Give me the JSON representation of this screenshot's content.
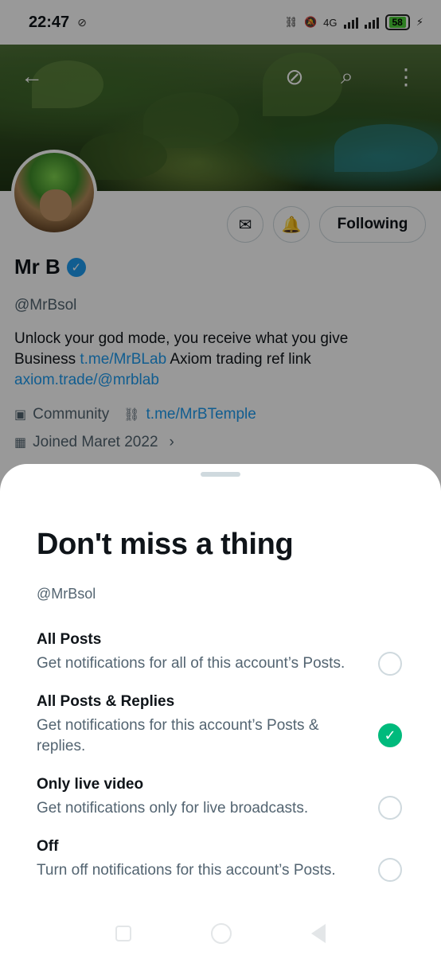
{
  "status_bar": {
    "time": "22:47",
    "network": "4G",
    "battery": "58"
  },
  "profile": {
    "name": "Mr B",
    "handle": "@MrBsol",
    "following_label": "Following",
    "bio_text_1": "Unlock your god mode, you receive what you give",
    "bio_text_2": "Business ",
    "bio_link_1": "t.me/MrBLab",
    "bio_text_3": " Axiom trading ref link",
    "bio_link_2": "axiom.trade/@mrblab",
    "community_label": "Community",
    "community_link": "t.me/MrBTemple",
    "joined": "Joined Maret 2022"
  },
  "sheet": {
    "title": "Don't miss a thing",
    "handle": "@MrBsol",
    "options": [
      {
        "title": "All Posts",
        "desc": "Get notifications for all of this account’s Posts.",
        "selected": false
      },
      {
        "title": "All Posts & Replies",
        "desc": "Get notifications for this account’s Posts & replies.",
        "selected": true
      },
      {
        "title": "Only live video",
        "desc": "Get notifications only for live broadcasts.",
        "selected": false
      },
      {
        "title": "Off",
        "desc": "Turn off notifications for this account’s Posts.",
        "selected": false
      }
    ]
  },
  "colors": {
    "accent": "#1d9bf0",
    "selected": "#00ba7c"
  }
}
